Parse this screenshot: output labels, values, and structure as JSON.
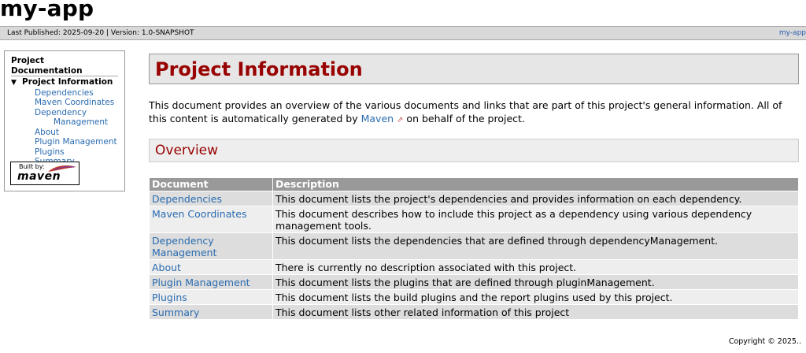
{
  "app": {
    "title": "my-app"
  },
  "publish_bar": {
    "left": "Last Published: 2025-09-20  |  Version: 1.0-SNAPSHOT",
    "right": "my-app"
  },
  "sidebar": {
    "heading": "Project Documentation",
    "current": "Project Information",
    "items": [
      "Dependencies",
      "Maven Coordinates",
      "Dependency",
      "Management",
      "About",
      "Plugin Management",
      "Plugins",
      "Summary"
    ],
    "built_by": {
      "label": "Built by:",
      "logo_text": "maven"
    }
  },
  "main": {
    "title": "Project Information",
    "intro_before": "This document provides an overview of the various documents and links that are part of this project's general information. All of this content is automatically generated by ",
    "intro_link": "Maven",
    "intro_after": " on behalf of the project.",
    "section_title": "Overview",
    "table": {
      "headers": [
        "Document",
        "Description"
      ],
      "rows": [
        {
          "document": "Dependencies",
          "description": "This document lists the project's dependencies and provides information on each dependency."
        },
        {
          "document": "Maven Coordinates",
          "description": "This document describes how to include this project as a dependency using various dependency management tools."
        },
        {
          "document": "Dependency Management",
          "description": "This document lists the dependencies that are defined through dependencyManagement."
        },
        {
          "document": "About",
          "description": "There is currently no description associated with this project."
        },
        {
          "document": "Plugin Management",
          "description": "This document lists the plugins that are defined through pluginManagement."
        },
        {
          "document": "Plugins",
          "description": "This document lists the build plugins and the report plugins used by this project."
        },
        {
          "document": "Summary",
          "description": "This document lists other related information of this project"
        }
      ]
    }
  },
  "footer": {
    "copyright": "Copyright © 2025.."
  },
  "colors": {
    "heading_red": "#990000",
    "link_blue": "#2a6bb0",
    "bar_gray": "#d9d9d9"
  }
}
